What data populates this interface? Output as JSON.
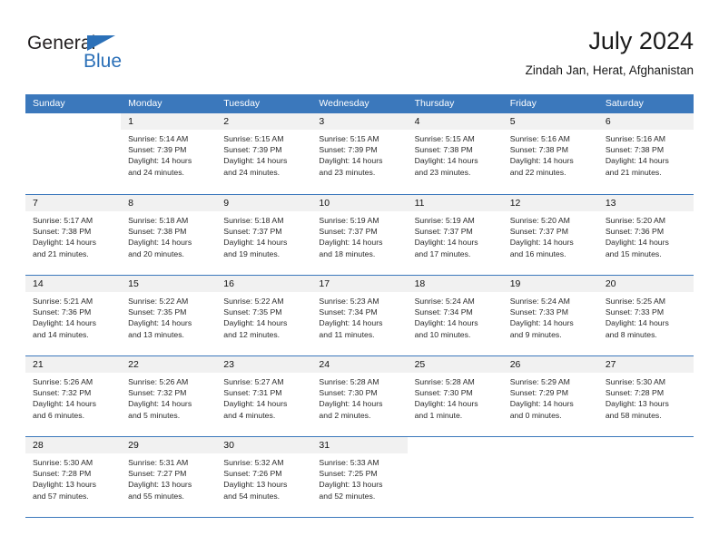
{
  "brand": {
    "name_top": "General",
    "name_bottom": "Blue"
  },
  "header": {
    "title": "July 2024",
    "subtitle": "Zindah Jan, Herat, Afghanistan"
  },
  "colors": {
    "header_blue": "#3b78bc",
    "brand_blue": "#2b70b8",
    "day_band": "#f1f1f1"
  },
  "weekdays": [
    "Sunday",
    "Monday",
    "Tuesday",
    "Wednesday",
    "Thursday",
    "Friday",
    "Saturday"
  ],
  "weeks": [
    [
      {
        "day": "",
        "sunrise": "",
        "sunset": "",
        "daylight1": "",
        "daylight2": ""
      },
      {
        "day": "1",
        "sunrise": "Sunrise: 5:14 AM",
        "sunset": "Sunset: 7:39 PM",
        "daylight1": "Daylight: 14 hours",
        "daylight2": "and 24 minutes."
      },
      {
        "day": "2",
        "sunrise": "Sunrise: 5:15 AM",
        "sunset": "Sunset: 7:39 PM",
        "daylight1": "Daylight: 14 hours",
        "daylight2": "and 24 minutes."
      },
      {
        "day": "3",
        "sunrise": "Sunrise: 5:15 AM",
        "sunset": "Sunset: 7:39 PM",
        "daylight1": "Daylight: 14 hours",
        "daylight2": "and 23 minutes."
      },
      {
        "day": "4",
        "sunrise": "Sunrise: 5:15 AM",
        "sunset": "Sunset: 7:38 PM",
        "daylight1": "Daylight: 14 hours",
        "daylight2": "and 23 minutes."
      },
      {
        "day": "5",
        "sunrise": "Sunrise: 5:16 AM",
        "sunset": "Sunset: 7:38 PM",
        "daylight1": "Daylight: 14 hours",
        "daylight2": "and 22 minutes."
      },
      {
        "day": "6",
        "sunrise": "Sunrise: 5:16 AM",
        "sunset": "Sunset: 7:38 PM",
        "daylight1": "Daylight: 14 hours",
        "daylight2": "and 21 minutes."
      }
    ],
    [
      {
        "day": "7",
        "sunrise": "Sunrise: 5:17 AM",
        "sunset": "Sunset: 7:38 PM",
        "daylight1": "Daylight: 14 hours",
        "daylight2": "and 21 minutes."
      },
      {
        "day": "8",
        "sunrise": "Sunrise: 5:18 AM",
        "sunset": "Sunset: 7:38 PM",
        "daylight1": "Daylight: 14 hours",
        "daylight2": "and 20 minutes."
      },
      {
        "day": "9",
        "sunrise": "Sunrise: 5:18 AM",
        "sunset": "Sunset: 7:37 PM",
        "daylight1": "Daylight: 14 hours",
        "daylight2": "and 19 minutes."
      },
      {
        "day": "10",
        "sunrise": "Sunrise: 5:19 AM",
        "sunset": "Sunset: 7:37 PM",
        "daylight1": "Daylight: 14 hours",
        "daylight2": "and 18 minutes."
      },
      {
        "day": "11",
        "sunrise": "Sunrise: 5:19 AM",
        "sunset": "Sunset: 7:37 PM",
        "daylight1": "Daylight: 14 hours",
        "daylight2": "and 17 minutes."
      },
      {
        "day": "12",
        "sunrise": "Sunrise: 5:20 AM",
        "sunset": "Sunset: 7:37 PM",
        "daylight1": "Daylight: 14 hours",
        "daylight2": "and 16 minutes."
      },
      {
        "day": "13",
        "sunrise": "Sunrise: 5:20 AM",
        "sunset": "Sunset: 7:36 PM",
        "daylight1": "Daylight: 14 hours",
        "daylight2": "and 15 minutes."
      }
    ],
    [
      {
        "day": "14",
        "sunrise": "Sunrise: 5:21 AM",
        "sunset": "Sunset: 7:36 PM",
        "daylight1": "Daylight: 14 hours",
        "daylight2": "and 14 minutes."
      },
      {
        "day": "15",
        "sunrise": "Sunrise: 5:22 AM",
        "sunset": "Sunset: 7:35 PM",
        "daylight1": "Daylight: 14 hours",
        "daylight2": "and 13 minutes."
      },
      {
        "day": "16",
        "sunrise": "Sunrise: 5:22 AM",
        "sunset": "Sunset: 7:35 PM",
        "daylight1": "Daylight: 14 hours",
        "daylight2": "and 12 minutes."
      },
      {
        "day": "17",
        "sunrise": "Sunrise: 5:23 AM",
        "sunset": "Sunset: 7:34 PM",
        "daylight1": "Daylight: 14 hours",
        "daylight2": "and 11 minutes."
      },
      {
        "day": "18",
        "sunrise": "Sunrise: 5:24 AM",
        "sunset": "Sunset: 7:34 PM",
        "daylight1": "Daylight: 14 hours",
        "daylight2": "and 10 minutes."
      },
      {
        "day": "19",
        "sunrise": "Sunrise: 5:24 AM",
        "sunset": "Sunset: 7:33 PM",
        "daylight1": "Daylight: 14 hours",
        "daylight2": "and 9 minutes."
      },
      {
        "day": "20",
        "sunrise": "Sunrise: 5:25 AM",
        "sunset": "Sunset: 7:33 PM",
        "daylight1": "Daylight: 14 hours",
        "daylight2": "and 8 minutes."
      }
    ],
    [
      {
        "day": "21",
        "sunrise": "Sunrise: 5:26 AM",
        "sunset": "Sunset: 7:32 PM",
        "daylight1": "Daylight: 14 hours",
        "daylight2": "and 6 minutes."
      },
      {
        "day": "22",
        "sunrise": "Sunrise: 5:26 AM",
        "sunset": "Sunset: 7:32 PM",
        "daylight1": "Daylight: 14 hours",
        "daylight2": "and 5 minutes."
      },
      {
        "day": "23",
        "sunrise": "Sunrise: 5:27 AM",
        "sunset": "Sunset: 7:31 PM",
        "daylight1": "Daylight: 14 hours",
        "daylight2": "and 4 minutes."
      },
      {
        "day": "24",
        "sunrise": "Sunrise: 5:28 AM",
        "sunset": "Sunset: 7:30 PM",
        "daylight1": "Daylight: 14 hours",
        "daylight2": "and 2 minutes."
      },
      {
        "day": "25",
        "sunrise": "Sunrise: 5:28 AM",
        "sunset": "Sunset: 7:30 PM",
        "daylight1": "Daylight: 14 hours",
        "daylight2": "and 1 minute."
      },
      {
        "day": "26",
        "sunrise": "Sunrise: 5:29 AM",
        "sunset": "Sunset: 7:29 PM",
        "daylight1": "Daylight: 14 hours",
        "daylight2": "and 0 minutes."
      },
      {
        "day": "27",
        "sunrise": "Sunrise: 5:30 AM",
        "sunset": "Sunset: 7:28 PM",
        "daylight1": "Daylight: 13 hours",
        "daylight2": "and 58 minutes."
      }
    ],
    [
      {
        "day": "28",
        "sunrise": "Sunrise: 5:30 AM",
        "sunset": "Sunset: 7:28 PM",
        "daylight1": "Daylight: 13 hours",
        "daylight2": "and 57 minutes."
      },
      {
        "day": "29",
        "sunrise": "Sunrise: 5:31 AM",
        "sunset": "Sunset: 7:27 PM",
        "daylight1": "Daylight: 13 hours",
        "daylight2": "and 55 minutes."
      },
      {
        "day": "30",
        "sunrise": "Sunrise: 5:32 AM",
        "sunset": "Sunset: 7:26 PM",
        "daylight1": "Daylight: 13 hours",
        "daylight2": "and 54 minutes."
      },
      {
        "day": "31",
        "sunrise": "Sunrise: 5:33 AM",
        "sunset": "Sunset: 7:25 PM",
        "daylight1": "Daylight: 13 hours",
        "daylight2": "and 52 minutes."
      },
      {
        "day": "",
        "sunrise": "",
        "sunset": "",
        "daylight1": "",
        "daylight2": ""
      },
      {
        "day": "",
        "sunrise": "",
        "sunset": "",
        "daylight1": "",
        "daylight2": ""
      },
      {
        "day": "",
        "sunrise": "",
        "sunset": "",
        "daylight1": "",
        "daylight2": ""
      }
    ]
  ]
}
